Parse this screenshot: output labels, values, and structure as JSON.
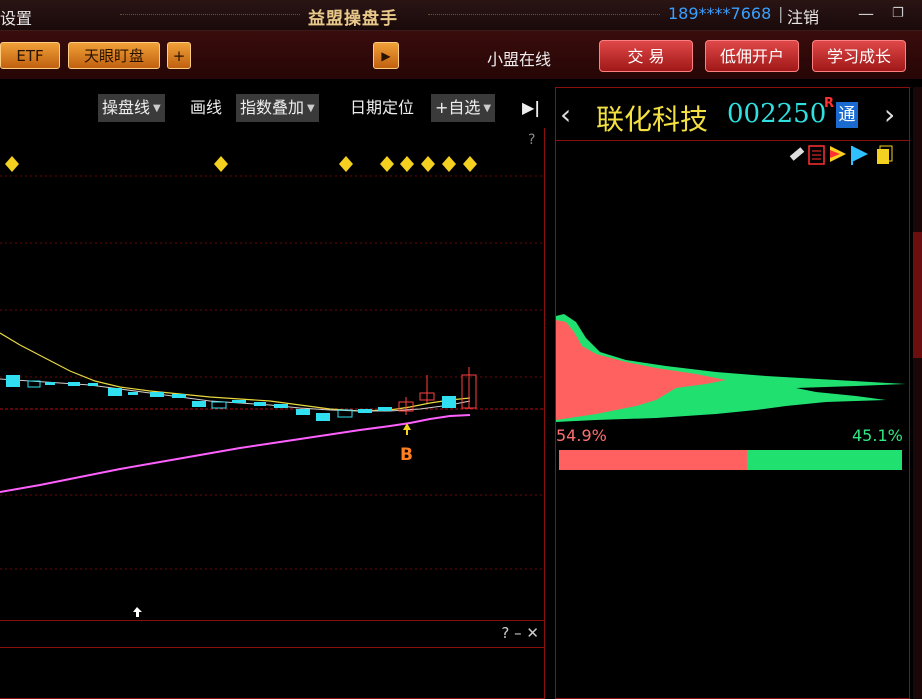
{
  "titlebar": {
    "settings_label": "设置",
    "settings_prefix": "置",
    "app_title": "益盟操盘手",
    "phone": "189****7668",
    "separator": "|",
    "logout": "注销",
    "minimize": "—",
    "restore": "❐"
  },
  "toolbar": {
    "etf": "ETF",
    "tianyan": "天眼盯盘",
    "plus": "+",
    "play": "▶",
    "online": "小盟在线",
    "trade": "交 易",
    "open_account": "低佣开户",
    "learn": "学习成长"
  },
  "chart_toolbar": {
    "caopan": "操盘线",
    "huaxian": "画线",
    "zhishu": "指数叠加",
    "riqi": "日期定位",
    "zixuan": "+自选",
    "collapse": "▶|"
  },
  "chart": {
    "question": "?",
    "buy_marker": "B",
    "lower_controls": "? – ✕"
  },
  "stock": {
    "name": "联化科技",
    "code": "002250",
    "r_mark": "R",
    "tong": "通",
    "prev": "‹",
    "next": "›"
  },
  "chip_distribution": {
    "left_pct": "54.9%",
    "right_pct": "45.1%",
    "left_ratio": 0.549,
    "right_ratio": 0.451,
    "colors": {
      "profit": "#ff6060",
      "loss": "#20e070"
    }
  },
  "colors": {
    "accent_red": "#8a1010",
    "stock_name": "#f4e040",
    "stock_code": "#30e0e0",
    "ma_line": "#e8d840",
    "avg_line": "#ff60ff",
    "up_candle": "#ff4040",
    "down_candle": "#30e0f0"
  }
}
